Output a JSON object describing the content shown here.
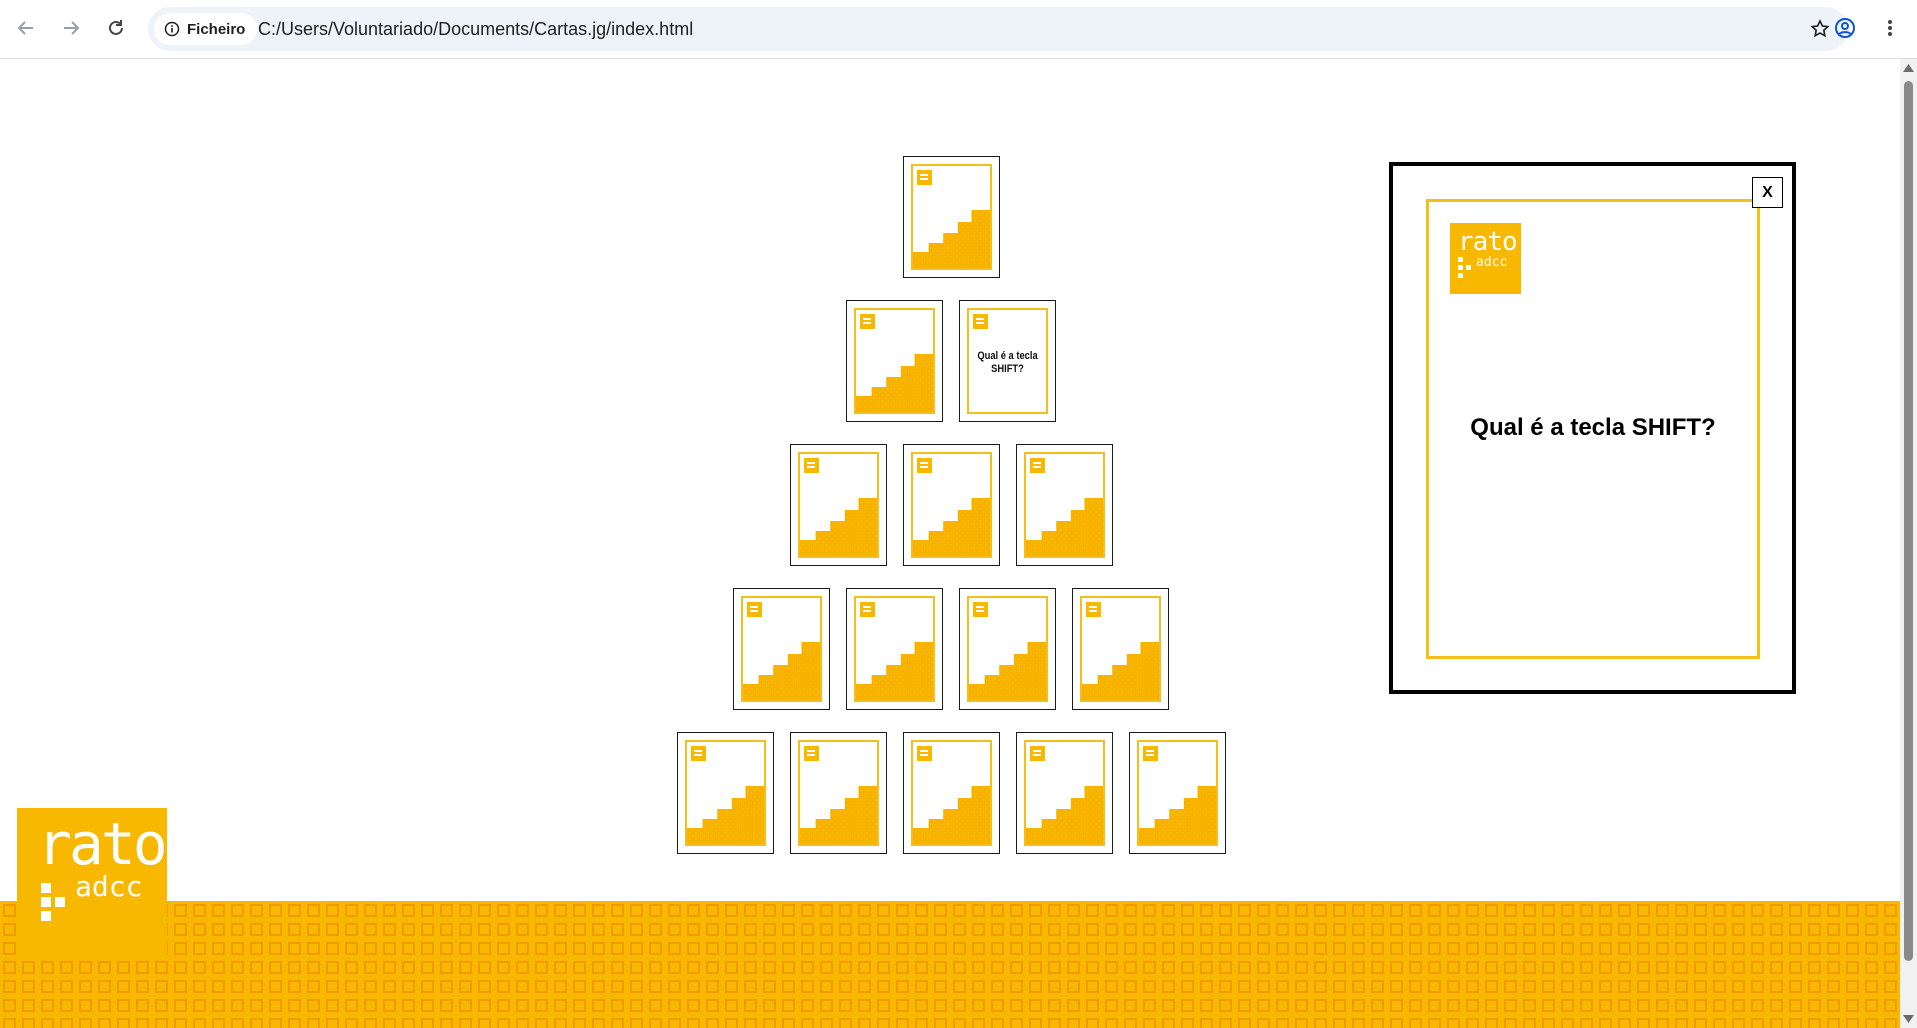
{
  "browser": {
    "site_chip_label": "Ficheiro",
    "url": "C:/Users/Voluntariado/Documents/Cartas.jg/index.html"
  },
  "cards": [
    {
      "face": "back"
    },
    {
      "face": "back"
    },
    {
      "face": "front",
      "question": "Qual é a tecla SHIFT?"
    },
    {
      "face": "back"
    },
    {
      "face": "back"
    },
    {
      "face": "back"
    },
    {
      "face": "back"
    },
    {
      "face": "back"
    },
    {
      "face": "back"
    },
    {
      "face": "back"
    },
    {
      "face": "back"
    },
    {
      "face": "back"
    },
    {
      "face": "back"
    },
    {
      "face": "back"
    },
    {
      "face": "back"
    }
  ],
  "modal": {
    "close_label": "X",
    "question": "Qual é a tecla SHIFT?",
    "logo_text_big": "rato",
    "logo_text_small": "adcc"
  },
  "footer_logo": {
    "text_big": "rato",
    "text_small": "adcc"
  },
  "colors": {
    "brand_yellow": "#f9b800",
    "card_border_yellow": "#f6be1d",
    "footer_pattern": "#f2a100"
  }
}
